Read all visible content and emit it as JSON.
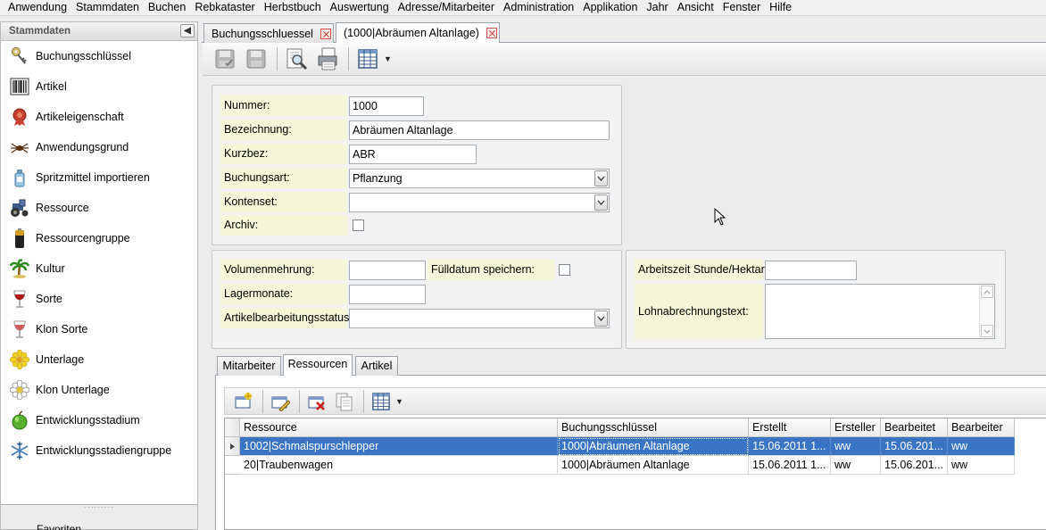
{
  "menubar": [
    "Anwendung",
    "Stammdaten",
    "Buchen",
    "Rebkataster",
    "Herbstbuch",
    "Auswertung",
    "Adresse/Mitarbeiter",
    "Administration",
    "Applikation",
    "Jahr",
    "Ansicht",
    "Fenster",
    "Hilfe"
  ],
  "sidebar": {
    "title": "Stammdaten",
    "items": [
      {
        "label": "Buchungsschlüssel",
        "icon": "key-icon"
      },
      {
        "label": "Artikel",
        "icon": "barcode-icon"
      },
      {
        "label": "Artikeleigenschaft",
        "icon": "badge-icon"
      },
      {
        "label": "Anwendungsgrund",
        "icon": "spider-icon"
      },
      {
        "label": "Spritzmittel importieren",
        "icon": "bottle-icon"
      },
      {
        "label": "Ressource",
        "icon": "tractor-icon"
      },
      {
        "label": "Ressourcengruppe",
        "icon": "battery-icon"
      },
      {
        "label": "Kultur",
        "icon": "palm-tree-icon"
      },
      {
        "label": "Sorte",
        "icon": "wine-glass-icon"
      },
      {
        "label": "Klon Sorte",
        "icon": "wine-glass-outline-icon"
      },
      {
        "label": "Unterlage",
        "icon": "flower-icon"
      },
      {
        "label": "Klon Unterlage",
        "icon": "flower-outline-icon"
      },
      {
        "label": "Entwicklungsstadium",
        "icon": "apple-icon"
      },
      {
        "label": "Entwicklungsstadiengruppe",
        "icon": "snowflake-icon"
      }
    ],
    "footer": "Favoriten"
  },
  "tabs": [
    {
      "label": "Buchungsschluessel"
    },
    {
      "label": "(1000|Abräumen Altanlage)"
    }
  ],
  "form": {
    "nummer_label": "Nummer:",
    "nummer_value": "1000",
    "bezeichnung_label": "Bezeichnung:",
    "bezeichnung_value": "Abräumen Altanlage",
    "kurzbez_label": "Kurzbez:",
    "kurzbez_value": "ABR",
    "buchungsart_label": "Buchungsart:",
    "buchungsart_value": "Pflanzung",
    "kontenset_label": "Kontenset:",
    "kontenset_value": "",
    "archiv_label": "Archiv:",
    "volumenmehrung_label": "Volumenmehrung:",
    "volumenmehrung_value": "",
    "fuelldatum_label": "Fülldatum speichern:",
    "lagermonate_label": "Lagermonate:",
    "lagermonate_value": "",
    "artikelstatus_label": "Artikelbearbeitungsstatus:",
    "artikelstatus_value": "",
    "arbeitszeit_label": "Arbeitszeit Stunde/Hektar:",
    "arbeitszeit_value": "",
    "lohntext_label": "Lohnabrechnungstext:",
    "lohntext_value": ""
  },
  "subtabs": [
    "Mitarbeiter",
    "Ressourcen",
    "Artikel"
  ],
  "active_subtab": "Ressourcen",
  "grid": {
    "columns": [
      "Ressource",
      "Buchungsschlüssel",
      "Erstellt",
      "Ersteller",
      "Bearbeitet",
      "Bearbeiter"
    ],
    "rows": [
      [
        "1002|Schmalspurschlepper",
        "1000|Abräumen Altanlage",
        "15.06.2011 1...",
        "ww",
        "15.06.201...",
        "ww"
      ],
      [
        "20|Traubenwagen",
        "1000|Abräumen Altanlage",
        "15.06.2011 1...",
        "ww",
        "15.06.201...",
        "ww"
      ]
    ],
    "selected_row": 0
  },
  "colors": {
    "selection": "#3a74c4",
    "label_bg": "#f6f6d8",
    "panel_bg": "#ececec"
  }
}
